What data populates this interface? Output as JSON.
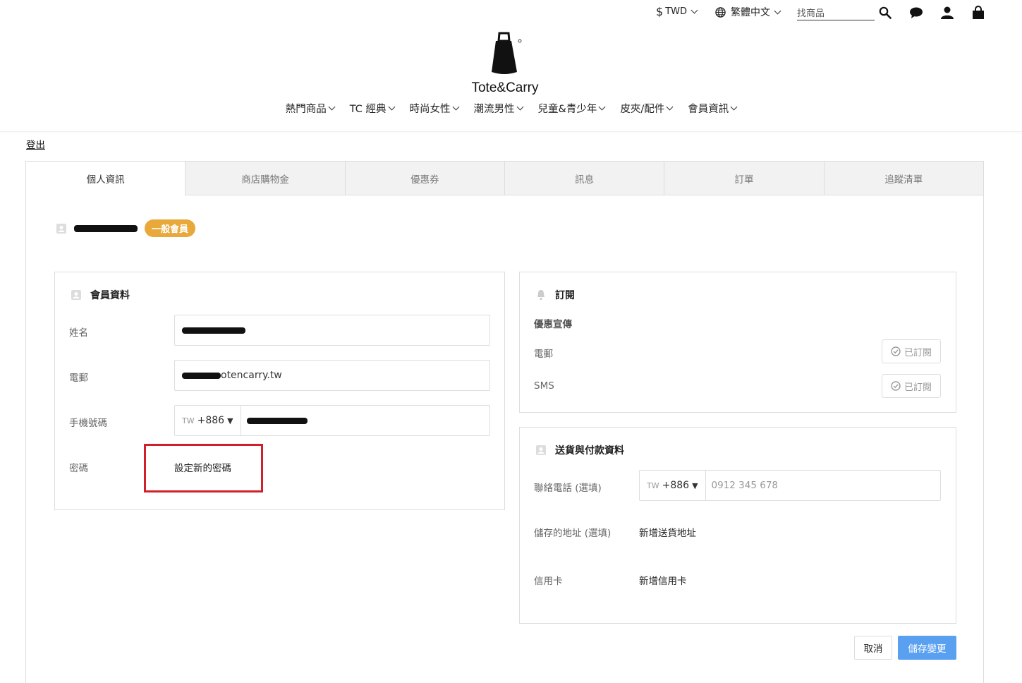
{
  "topbar": {
    "currency": "TWD",
    "currency_symbol": "$",
    "language": "繁體中文",
    "search_placeholder": "找商品"
  },
  "logo": {
    "text": "Tote&Carry"
  },
  "nav": [
    "熱門商品",
    "TC 經典",
    "時尚女性",
    "潮流男性",
    "兒童&青少年",
    "皮夾/配件",
    "會員資訊"
  ],
  "logout": "登出",
  "tabs": [
    "個人資訊",
    "商店購物金",
    "優惠券",
    "訊息",
    "訂單",
    "追蹤清單"
  ],
  "member": {
    "tier_badge": "一般會員"
  },
  "profile": {
    "title": "會員資料",
    "name_label": "姓名",
    "email_label": "電郵",
    "email_value_suffix": "otencarry.tw",
    "phone_label": "手機號碼",
    "phone_country": "TW",
    "phone_code": "+886",
    "password_label": "密碼",
    "password_link": "設定新的密碼"
  },
  "subscription": {
    "title": "訂閱",
    "section": "優惠宣傳",
    "email_label": "電郵",
    "sms_label": "SMS",
    "subscribed_label": "已訂閱"
  },
  "delivery": {
    "title": "送貨與付款資料",
    "phone_label": "聯絡電話 (選填)",
    "phone_country": "TW",
    "phone_code": "+886",
    "phone_placeholder": "0912 345 678",
    "address_label": "儲存的地址 (選填)",
    "address_link": "新增送貨地址",
    "card_label": "信用卡",
    "card_link": "新增信用卡"
  },
  "actions": {
    "cancel": "取消",
    "save": "儲存變更"
  },
  "colors": {
    "badge": "#e8a83a",
    "primary": "#5aa0f0",
    "highlight": "#d0202a"
  }
}
